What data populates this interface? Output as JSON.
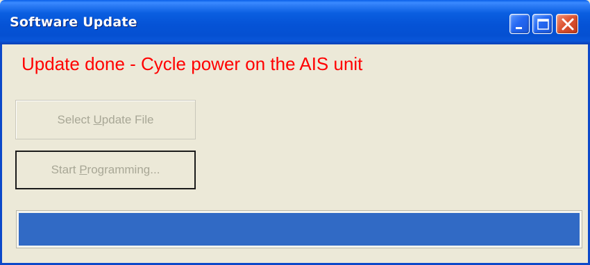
{
  "window": {
    "title": "Software Update",
    "controls": [
      "minimize-icon",
      "maximize-icon",
      "close-icon"
    ]
  },
  "status": {
    "message": "Update done - Cycle power on the AIS unit",
    "color": "#ff0000"
  },
  "buttons": {
    "select_update_file": {
      "pre": "Select ",
      "mnemonic": "U",
      "post": "pdate File",
      "enabled": false
    },
    "start_programming": {
      "pre": "Start ",
      "mnemonic": "P",
      "post": "rogramming...",
      "enabled": false
    }
  },
  "progress": {
    "fraction": 1.0,
    "fill_color": "#316ac5"
  }
}
